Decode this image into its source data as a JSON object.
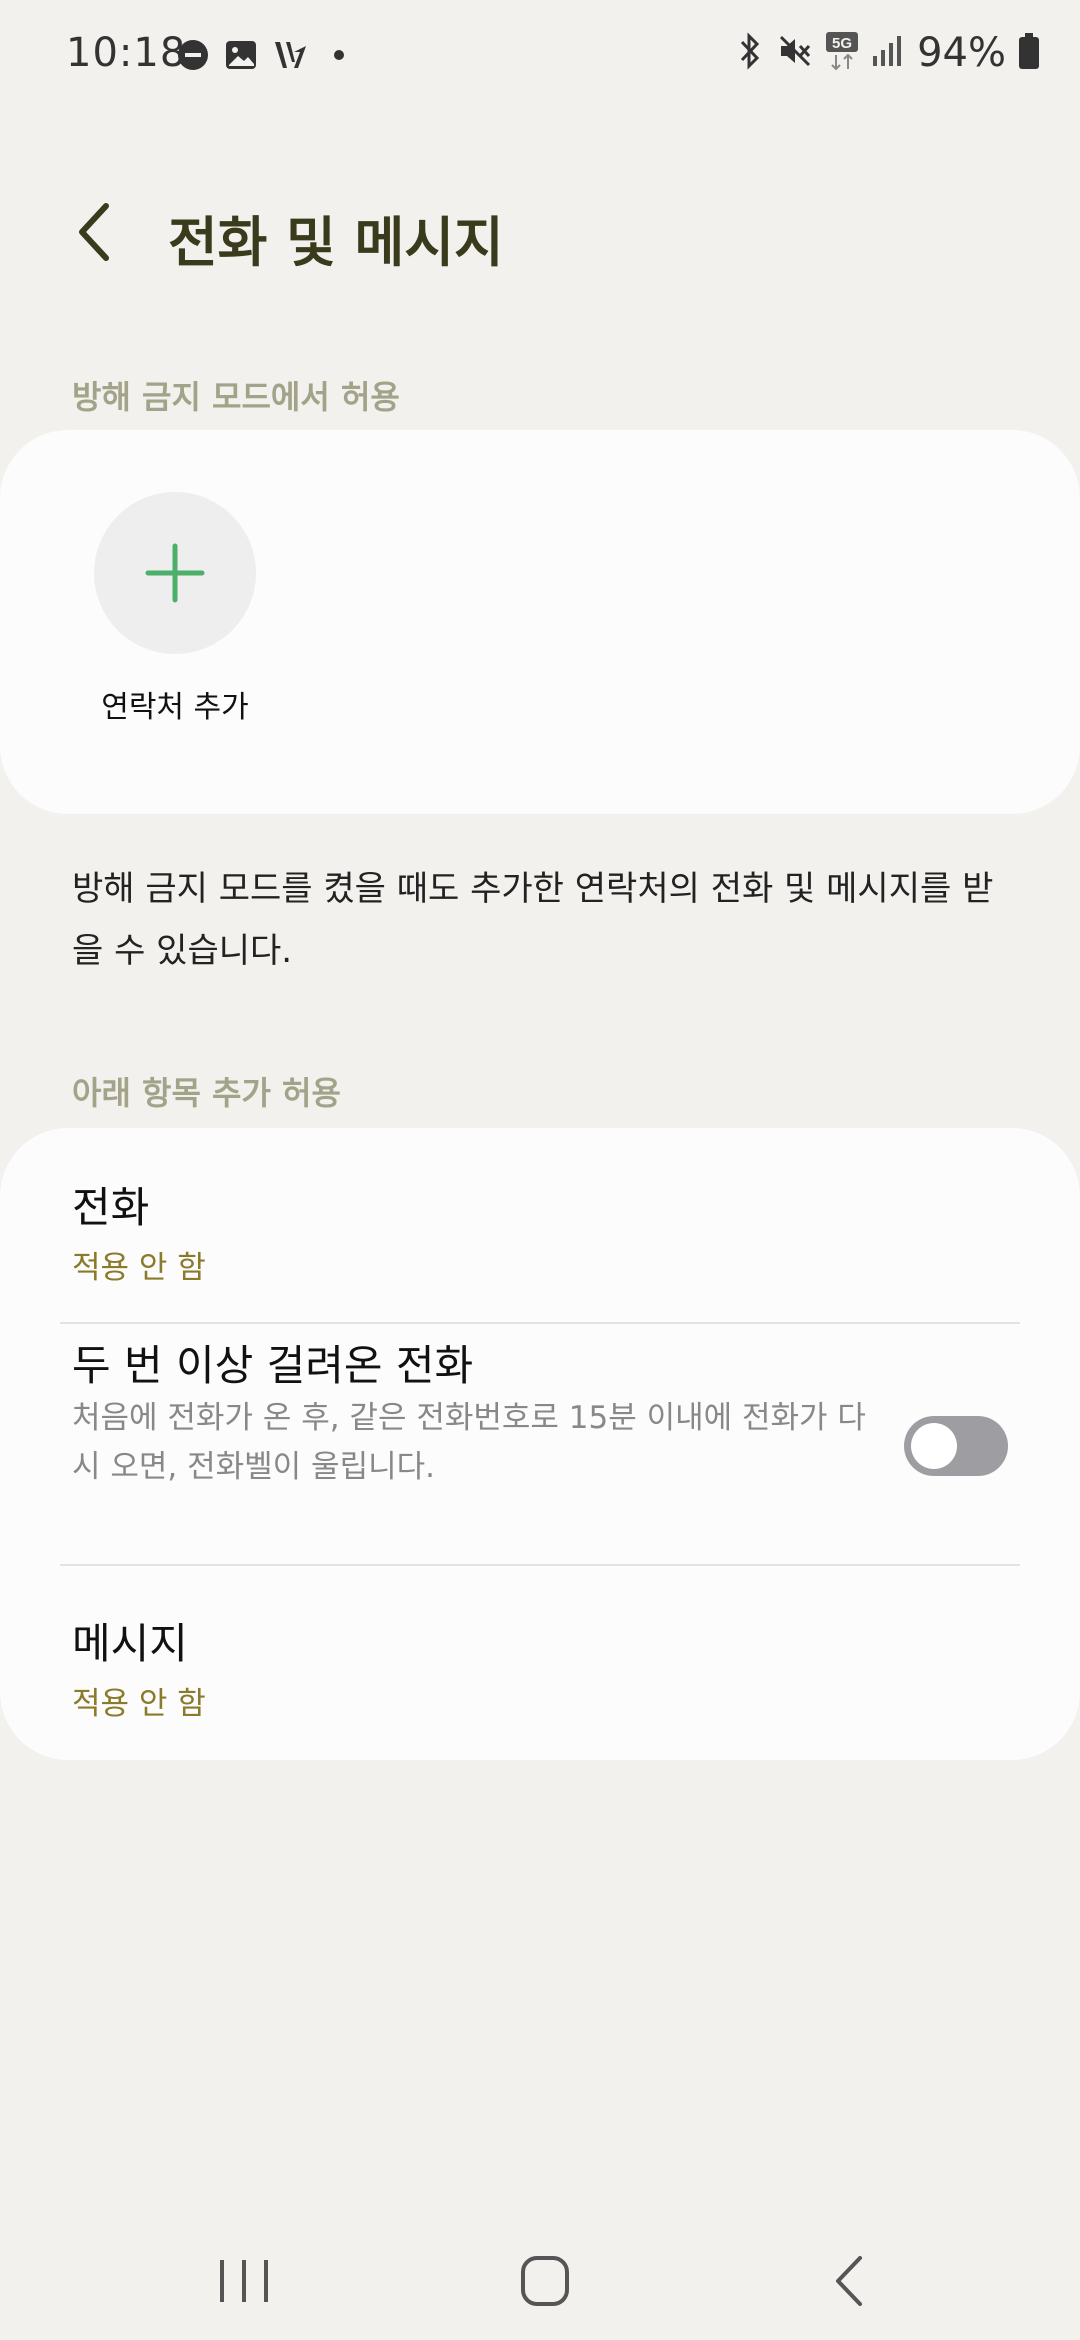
{
  "status_bar": {
    "time": "10:18",
    "battery_percent": "94%",
    "network": "5G",
    "left_icons": [
      "do-not-disturb-icon",
      "gallery-icon",
      "app-notification-icon",
      "more-dot-icon"
    ],
    "right_icons": [
      "bluetooth-icon",
      "mute-icon",
      "5g-icon",
      "signal-icon",
      "battery-icon"
    ]
  },
  "header": {
    "title": "전화 및 메시지",
    "back_icon": "chevron-left-icon"
  },
  "sections": {
    "allow_in_dnd": {
      "header": "방해 금지 모드에서 허용",
      "add_contact_label": "연락처 추가",
      "description": "방해 금지 모드를 켰을 때도 추가한 연락처의 전화 및 메시지를 받을 수 있습니다."
    },
    "additional": {
      "header": "아래 항목 추가 허용",
      "calls": {
        "title": "전화",
        "value": "적용 안 함"
      },
      "repeat_callers": {
        "title": "두 번 이상 걸려온 전화",
        "description": "처음에 전화가 온 후, 같은 전화번호로 15분 이내에 전화가 다시 오면, 전화벨이 울립니다.",
        "enabled": false
      },
      "messages": {
        "title": "메시지",
        "value": "적용 안 함"
      }
    }
  },
  "colors": {
    "background": "#f2f1ee",
    "card": "#fcfcfc",
    "title": "#3a3b1c",
    "section_header": "#a3a38a",
    "accent_value": "#8a7a2a",
    "plus_icon": "#4caf6a",
    "toggle_off": "#9e9ea2"
  },
  "nav_bar": {
    "items": [
      "recent-apps-icon",
      "home-icon",
      "back-icon"
    ]
  }
}
